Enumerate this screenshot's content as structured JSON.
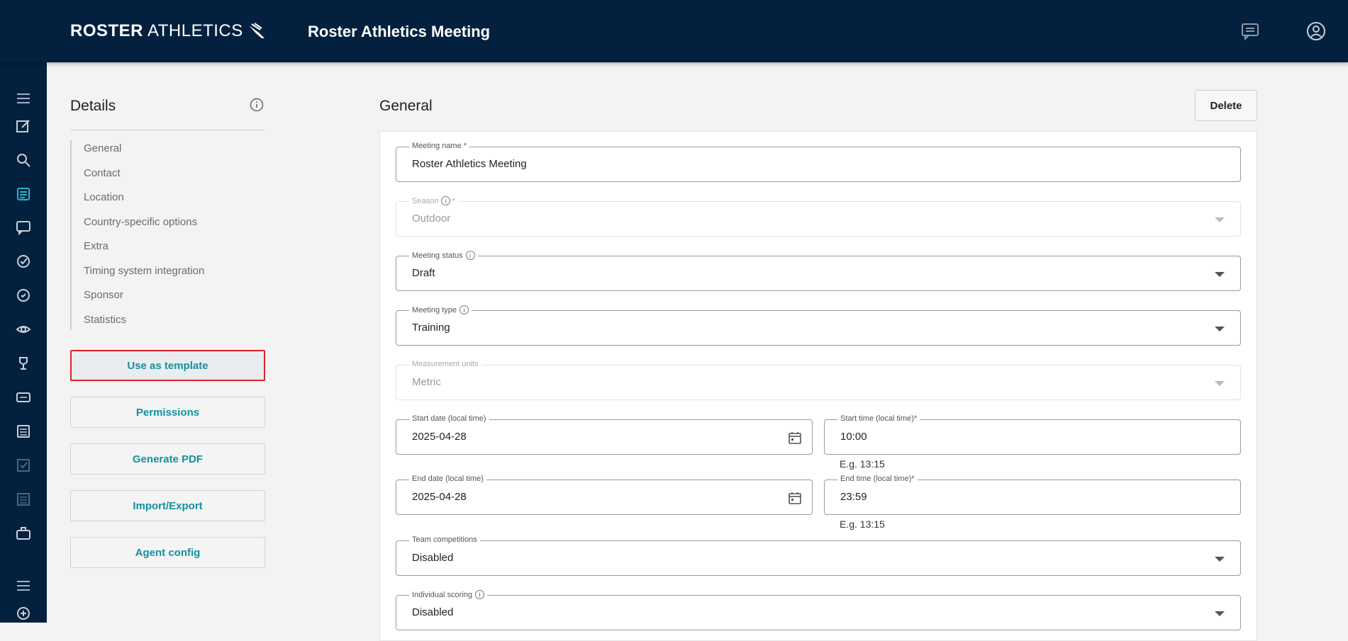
{
  "header": {
    "logo_bold": "ROSTER",
    "logo_light": "ATHLETICS",
    "title": "Roster Athletics Meeting"
  },
  "details": {
    "title": "Details",
    "nav": [
      "General",
      "Contact",
      "Location",
      "Country-specific options",
      "Extra",
      "Timing system integration",
      "Sponsor",
      "Statistics"
    ],
    "buttons": {
      "template": "Use as template",
      "permissions": "Permissions",
      "pdf": "Generate PDF",
      "import_export": "Import/Export",
      "agent_config": "Agent config"
    }
  },
  "main": {
    "title": "General",
    "delete_label": "Delete",
    "fields": {
      "meeting_name": {
        "label": "Meeting name *",
        "value": "Roster Athletics Meeting"
      },
      "season": {
        "label": "Season",
        "required": "*",
        "value": "Outdoor"
      },
      "status": {
        "label": "Meeting status",
        "value": "Draft"
      },
      "type": {
        "label": "Meeting type",
        "value": "Training"
      },
      "units": {
        "label": "Measurement units",
        "value": "Metric"
      },
      "start_date": {
        "label": "Start date (local time)",
        "value": "2025-04-28"
      },
      "start_time": {
        "label": "Start time (local time)*",
        "value": "10:00",
        "hint": "E.g. 13:15"
      },
      "end_date": {
        "label": "End date (local time)",
        "value": "2025-04-28"
      },
      "end_time": {
        "label": "End time (local time)*",
        "value": "23:59",
        "hint": "E.g. 13:15"
      },
      "team": {
        "label": "Team competitions",
        "value": "Disabled"
      },
      "individual": {
        "label": "Individual scoring",
        "value": "Disabled"
      }
    }
  },
  "colors": {
    "header_bg": "#03213f",
    "accent": "#13919e",
    "highlight": "#e0202a"
  }
}
